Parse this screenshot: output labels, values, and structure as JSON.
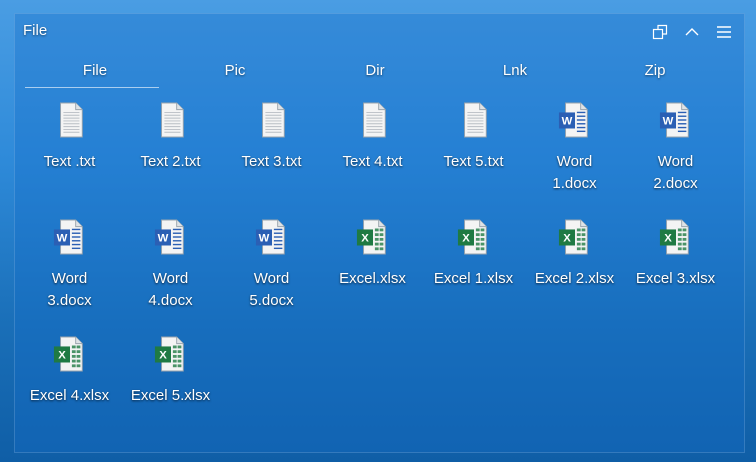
{
  "window": {
    "title": "File"
  },
  "icons": {
    "restore": "restore-icon",
    "collapse": "chevron-up-icon",
    "menu": "hamburger-menu-icon"
  },
  "tabs": [
    {
      "label": "File",
      "active": true
    },
    {
      "label": "Pic",
      "active": false
    },
    {
      "label": "Dir",
      "active": false
    },
    {
      "label": "Lnk",
      "active": false
    },
    {
      "label": "Zip",
      "active": false
    }
  ],
  "files": [
    {
      "name": "Text .txt",
      "type": "txt"
    },
    {
      "name": "Text 2.txt",
      "type": "txt"
    },
    {
      "name": "Text 3.txt",
      "type": "txt"
    },
    {
      "name": "Text 4.txt",
      "type": "txt"
    },
    {
      "name": "Text 5.txt",
      "type": "txt"
    },
    {
      "name": "Word\n1.docx",
      "type": "docx"
    },
    {
      "name": "Word\n2.docx",
      "type": "docx"
    },
    {
      "name": "Word\n3.docx",
      "type": "docx"
    },
    {
      "name": "Word\n4.docx",
      "type": "docx"
    },
    {
      "name": "Word\n5.docx",
      "type": "docx"
    },
    {
      "name": "Excel.xlsx",
      "type": "xlsx"
    },
    {
      "name": "Excel 1.xlsx",
      "type": "xlsx"
    },
    {
      "name": "Excel 2.xlsx",
      "type": "xlsx"
    },
    {
      "name": "Excel 3.xlsx",
      "type": "xlsx"
    },
    {
      "name": "Excel 4.xlsx",
      "type": "xlsx"
    },
    {
      "name": "Excel 5.xlsx",
      "type": "xlsx"
    }
  ],
  "colors": {
    "word": "#2b5fb4",
    "excel": "#1f7a43",
    "paper": "#f4f4f4"
  }
}
